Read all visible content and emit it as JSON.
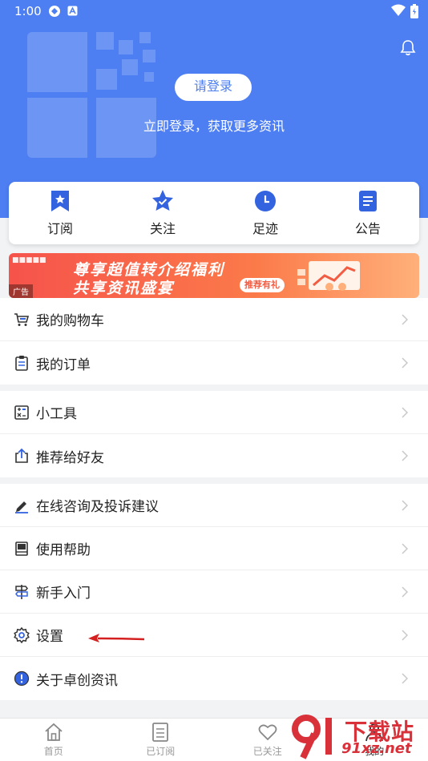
{
  "status_bar": {
    "time": "1:00"
  },
  "header": {
    "login_button": "请登录",
    "login_tip": "立即登录，获取更多资讯"
  },
  "quick_nav": [
    {
      "label": "订阅",
      "icon": "bookmark-star-icon"
    },
    {
      "label": "关注",
      "icon": "star-check-icon"
    },
    {
      "label": "足迹",
      "icon": "clock-icon"
    },
    {
      "label": "公告",
      "icon": "document-icon"
    }
  ],
  "banner": {
    "line1": "尊享超值转介绍福利",
    "line2": "共享资讯盛宴",
    "pill": "推荐有礼",
    "ad_tag": "广告"
  },
  "menu": {
    "group1": [
      {
        "label": "我的购物车",
        "icon": "cart-icon"
      },
      {
        "label": "我的订单",
        "icon": "clipboard-icon"
      }
    ],
    "group2": [
      {
        "label": "小工具",
        "icon": "tool-icon"
      },
      {
        "label": "推荐给好友",
        "icon": "share-icon"
      }
    ],
    "group3": [
      {
        "label": "在线咨询及投诉建议",
        "icon": "pen-icon"
      },
      {
        "label": "使用帮助",
        "icon": "book-icon"
      },
      {
        "label": "新手入门",
        "icon": "signpost-icon"
      },
      {
        "label": "设置",
        "icon": "gear-icon"
      },
      {
        "label": "关于卓创资讯",
        "icon": "info-icon"
      }
    ]
  },
  "bottom_nav": [
    {
      "label": "首页",
      "icon": "home-icon"
    },
    {
      "label": "已订阅",
      "icon": "list-icon"
    },
    {
      "label": "已关注",
      "icon": "heart-icon"
    },
    {
      "label": "我的",
      "icon": "person-icon"
    }
  ],
  "watermark": {
    "text": "下载站",
    "url": "91xz.net"
  },
  "colors": {
    "brand": "#4d7ef2",
    "banner": "#f6534b",
    "arrow": "#d42020"
  }
}
